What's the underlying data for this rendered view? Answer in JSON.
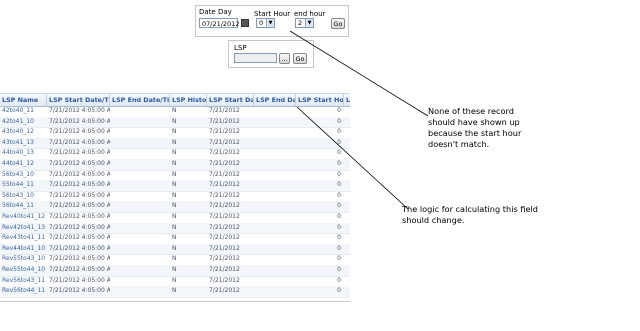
{
  "filters": {
    "date_day_label": "Date Day",
    "date_value": "07/21/2012",
    "start_hour_label": "Start Hour",
    "start_hour_value": "0",
    "end_hour_label": "end hour",
    "end_hour_value": "2",
    "go_label": "Go"
  },
  "lsp_filter": {
    "label": "LSP",
    "value": "",
    "lookup_label": "...",
    "go_label": "Go"
  },
  "grid": {
    "columns": [
      "LSP Name",
      "LSP Start Date/Time",
      "LSP End Date/Time",
      "LSP History",
      "LSP Start Date",
      "LSP End Date",
      "LSP Start Hour",
      "L"
    ],
    "rows": [
      [
        "42to40_11",
        "7/21/2012 4:05:00 AM",
        "",
        "N",
        "7/21/2012",
        "",
        "0"
      ],
      [
        "42to41_10",
        "7/21/2012 4:05:00 AM",
        "",
        "N",
        "7/21/2012",
        "",
        "0"
      ],
      [
        "43to40_12",
        "7/21/2012 4:05:00 AM",
        "",
        "N",
        "7/21/2012",
        "",
        "0"
      ],
      [
        "43to41_13",
        "7/21/2012 4:05:00 AM",
        "",
        "N",
        "7/21/2012",
        "",
        "0"
      ],
      [
        "44to40_13",
        "7/21/2012 4:05:00 AM",
        "",
        "N",
        "7/21/2012",
        "",
        "0"
      ],
      [
        "44to41_12",
        "7/21/2012 4:05:00 AM",
        "",
        "N",
        "7/21/2012",
        "",
        "0"
      ],
      [
        "56to43_10",
        "7/21/2012 4:05:00 AM",
        "",
        "N",
        "7/21/2012",
        "",
        "0"
      ],
      [
        "55to44_11",
        "7/21/2012 4:05:00 AM",
        "",
        "N",
        "7/21/2012",
        "",
        "0"
      ],
      [
        "56to43_10",
        "7/21/2012 4:05:00 AM",
        "",
        "N",
        "7/21/2012",
        "",
        "0"
      ],
      [
        "56to44_11",
        "7/21/2012 4:05:00 AM",
        "",
        "N",
        "7/21/2012",
        "",
        "0"
      ],
      [
        "Rev40to41_12",
        "7/21/2012 4:05:00 AM",
        "",
        "N",
        "7/21/2012",
        "",
        "0"
      ],
      [
        "Rev42to41_13",
        "7/21/2012 4:05:00 AM",
        "",
        "N",
        "7/21/2012",
        "",
        "0"
      ],
      [
        "Rev43to41_11",
        "7/21/2012 4:05:00 AM",
        "",
        "N",
        "7/21/2012",
        "",
        "0"
      ],
      [
        "Rev44to41_10",
        "7/21/2012 4:05:00 AM",
        "",
        "N",
        "7/21/2012",
        "",
        "0"
      ],
      [
        "Rev55to43_10",
        "7/21/2012 4:05:00 AM",
        "",
        "N",
        "7/21/2012",
        "",
        "0"
      ],
      [
        "Rev55to44_10",
        "7/21/2012 4:05:00 AM",
        "",
        "N",
        "7/21/2012",
        "",
        "0"
      ],
      [
        "Rev56to43_11",
        "7/21/2012 4:05:00 AM",
        "",
        "N",
        "7/21/2012",
        "",
        "0"
      ],
      [
        "Rev56to44_11",
        "7/21/2012 4:05:00 AM",
        "",
        "N",
        "7/21/2012",
        "",
        "0"
      ]
    ]
  },
  "annotations": {
    "note1": "None of these record should have shown up because the start hour doesn't match.",
    "note2": "The logic for calculating this field should change."
  },
  "colors": {
    "header_text": "#2c59a0",
    "link_text": "#3a64a6"
  }
}
